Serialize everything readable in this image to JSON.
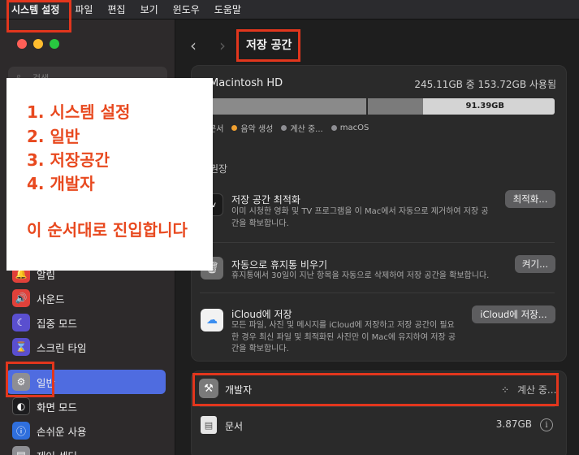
{
  "menubar": {
    "app": "시스템 설정",
    "items": [
      "파일",
      "편집",
      "보기",
      "윈도우",
      "도움말"
    ]
  },
  "sidebar": {
    "search_placeholder": "검색",
    "items": [
      {
        "label": "알림",
        "icon": "bell-icon",
        "color": "#e0413a"
      },
      {
        "label": "사운드",
        "icon": "speaker-icon",
        "color": "#e0413a"
      },
      {
        "label": "집중 모드",
        "icon": "moon-icon",
        "color": "#5a4fcf"
      },
      {
        "label": "스크린 타임",
        "icon": "hourglass-icon",
        "color": "#5a4fcf"
      },
      {
        "label": "일반",
        "icon": "gear-icon",
        "color": "#8e8e93",
        "selected": true
      },
      {
        "label": "화면 모드",
        "icon": "appearance-icon",
        "color": "#1c1c1e"
      },
      {
        "label": "손쉬운 사용",
        "icon": "accessibility-icon",
        "color": "#2f6fdd"
      },
      {
        "label": "제어 센터",
        "icon": "control-center-icon",
        "color": "#8e8e93"
      }
    ]
  },
  "header": {
    "back": "‹",
    "forward": "›",
    "title": "저장 공간"
  },
  "storage": {
    "disk_name": "Macintosh HD",
    "usage": "245.11GB 중 153.72GB 사용됨",
    "free_label": "91.39GB",
    "legend": [
      {
        "label": "문서",
        "color": "#8e8e93"
      },
      {
        "label": "음악 생성",
        "color": "#f0a030"
      },
      {
        "label": "계산 중...",
        "color": "#8e8e93"
      },
      {
        "label": "macOS",
        "color": "#8e8e93"
      }
    ]
  },
  "recommend": {
    "title": "권장",
    "items": [
      {
        "title": "저장 공간 최적화",
        "desc": "이미 시청한 영화 및 TV 프로그램을 이 Mac에서 자동으로 제거하여 저장 공간을 확보합니다.",
        "button": "최적화...",
        "icon": "tv-icon"
      },
      {
        "title": "자동으로 휴지통 비우기",
        "desc": "휴지통에서 30일이 지난 항목을 자동으로 삭제하여 저장 공간을 확보합니다.",
        "button": "켜기...",
        "icon": "trash-icon"
      },
      {
        "title": "iCloud에 저장",
        "desc": "모든 파일, 사진 및 메시지를 iCloud에 저장하고 저장 공간이 필요한 경우 최신 파일 및 최적화된 사진만 이 Mac에 유지하여 저장 공간을 확보합니다.",
        "button": "iCloud에 저장...",
        "icon": "icloud-icon"
      }
    ]
  },
  "categories": [
    {
      "title": "개발자",
      "status": "계산 중...",
      "icon": "hammer-icon"
    },
    {
      "title": "문서",
      "size": "3.87GB",
      "icon": "document-icon"
    }
  ],
  "annotation": {
    "lines": [
      "1. 시스템 설정",
      "2. 일반",
      "3. 저장공간",
      "4. 개발자",
      "",
      "이 순서대로 진입합니다"
    ],
    "color": "#e8491f"
  }
}
